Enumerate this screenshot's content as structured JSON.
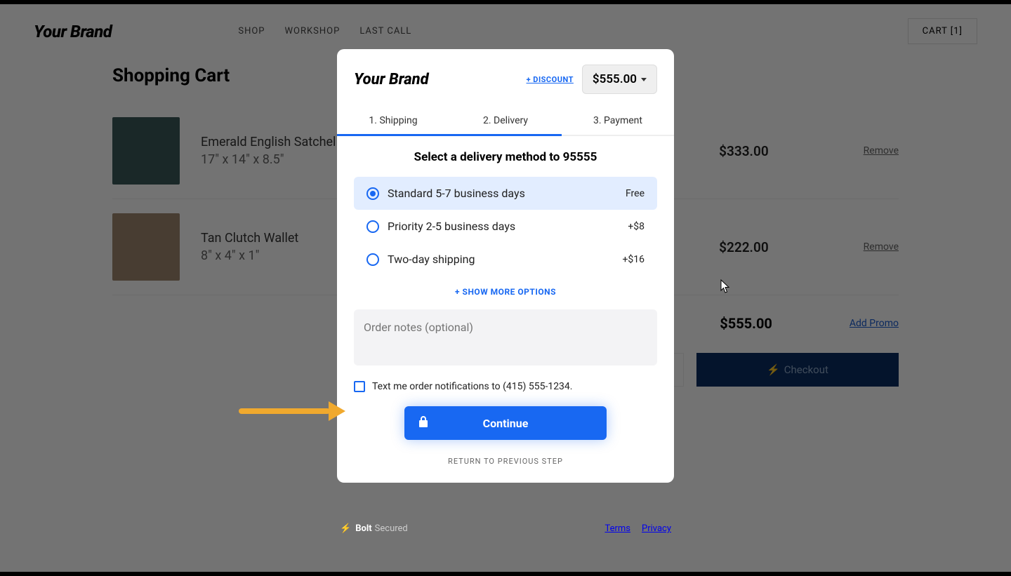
{
  "header": {
    "brand": "Your Brand",
    "nav": [
      "SHOP",
      "WORKSHOP",
      "LAST CALL"
    ],
    "cart_label": "CART [1]"
  },
  "cart": {
    "title": "Shopping Cart",
    "items": [
      {
        "name": "Emerald English Satchel",
        "dims": "17\" x 14\" x 8.5\"",
        "price": "$333.00",
        "remove": "Remove"
      },
      {
        "name": "Tan Clutch Wallet",
        "dims": "8\" x 4\" x 1\"",
        "price": "$222.00",
        "remove": "Remove"
      }
    ],
    "total": "$555.00",
    "add_promo": "Add Promo",
    "checkout_label": "Checkout"
  },
  "modal": {
    "brand": "Your Brand",
    "discount_link": "+ DISCOUNT",
    "total": "$555.00",
    "tabs": [
      "1. Shipping",
      "2. Delivery",
      "3. Payment"
    ],
    "delivery_title": "Select a delivery method to 95555",
    "options": [
      {
        "label": "Standard 5-7 business days",
        "price": "Free",
        "selected": true
      },
      {
        "label": "Priority 2-5 business days",
        "price": "+$8",
        "selected": false
      },
      {
        "label": "Two-day shipping",
        "price": "+$16",
        "selected": false
      }
    ],
    "show_more": "+ SHOW MORE OPTIONS",
    "notes_placeholder": "Order notes (optional)",
    "sms_label": "Text me order notifications to (415) 555-1234.",
    "continue_label": "Continue",
    "return_label": "RETURN TO PREVIOUS STEP"
  },
  "footer": {
    "bolt_name": "Bolt",
    "bolt_secured": "Secured",
    "terms": "Terms",
    "privacy": "Privacy"
  }
}
